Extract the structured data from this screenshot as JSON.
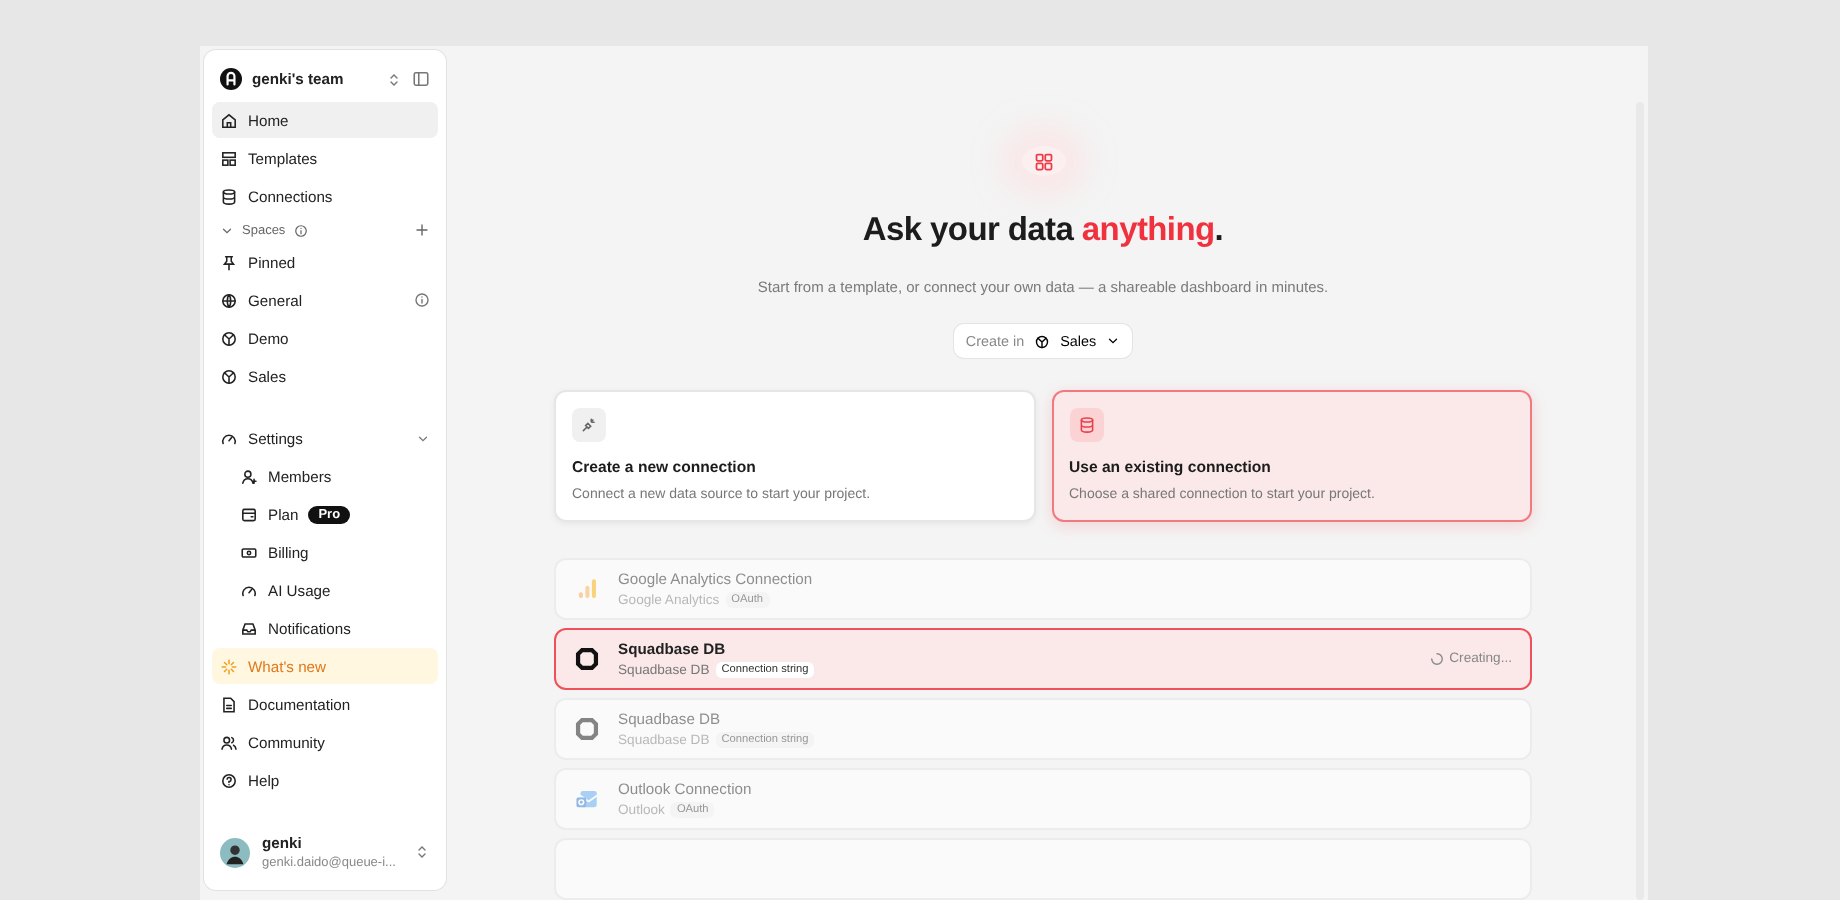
{
  "team": {
    "name": "genki's team"
  },
  "nav": [
    {
      "label": "Home",
      "selected": true
    },
    {
      "label": "Templates",
      "selected": false
    },
    {
      "label": "Connections",
      "selected": false
    }
  ],
  "spaces": {
    "label": "Spaces",
    "expanded": true,
    "items": [
      {
        "label": "Pinned",
        "info": false
      },
      {
        "label": "General",
        "info": true
      },
      {
        "label": "Demo",
        "info": false
      },
      {
        "label": "Sales",
        "info": false
      }
    ]
  },
  "settings": {
    "label": "Settings",
    "expanded": true,
    "items": [
      {
        "label": "Members"
      },
      {
        "label": "Plan",
        "badge": "Pro"
      },
      {
        "label": "Billing"
      },
      {
        "label": "AI Usage"
      },
      {
        "label": "Notifications"
      }
    ]
  },
  "whats_new": {
    "label": "What's new",
    "highlighted": true
  },
  "links": [
    {
      "label": "Documentation"
    },
    {
      "label": "Community"
    },
    {
      "label": "Help"
    }
  ],
  "user": {
    "name": "genki",
    "email": "genki.daido@queue-i..."
  },
  "headline": {
    "text": "Ask your data",
    "highlight": "anything",
    "end": "."
  },
  "subtitle": "Start from a template, or connect your own data — a shareable dashboard in minutes.",
  "create_in": {
    "label": "Create in",
    "value": "Sales"
  },
  "options": [
    {
      "title": "Create a new connection",
      "description": "Connect a new data source to start your project.",
      "selected": false
    },
    {
      "title": "Use an existing connection",
      "description": "Choose a shared connection to start your project.",
      "selected": true
    }
  ],
  "connections": [
    {
      "name": "Google Analytics Connection",
      "source": "Google Analytics",
      "auth": "OAuth",
      "selected": false,
      "disabled": true
    },
    {
      "name": "Squadbase DB",
      "source": "Squadbase DB",
      "auth": "Connection string",
      "selected": true,
      "disabled": false,
      "status": "Creating..."
    },
    {
      "name": "Squadbase DB",
      "source": "Squadbase DB",
      "auth": "Connection string",
      "selected": false,
      "disabled": true
    },
    {
      "name": "Outlook Connection",
      "source": "Outlook",
      "auth": "OAuth",
      "selected": false,
      "disabled": true
    }
  ]
}
